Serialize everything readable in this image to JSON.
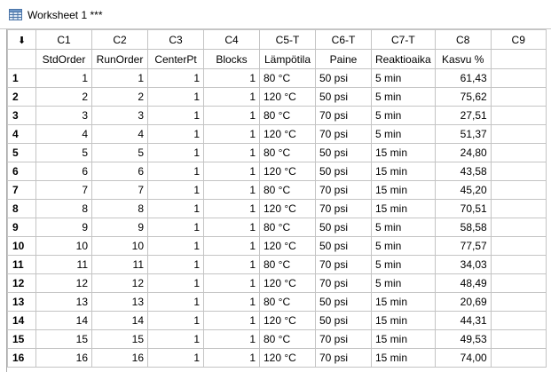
{
  "window": {
    "title": "Worksheet 1 ***",
    "icon": "worksheet-grid-icon"
  },
  "corner": {
    "label": "⬇",
    "icon": "sort-arrow-icon"
  },
  "columns": [
    {
      "id": "C1",
      "name": "StdOrder",
      "align": "num"
    },
    {
      "id": "C2",
      "name": "RunOrder",
      "align": "num"
    },
    {
      "id": "C3",
      "name": "CenterPt",
      "align": "num"
    },
    {
      "id": "C4",
      "name": "Blocks",
      "align": "num"
    },
    {
      "id": "C5-T",
      "name": "Lämpötila",
      "align": "txt"
    },
    {
      "id": "C6-T",
      "name": "Paine",
      "align": "txt"
    },
    {
      "id": "C7-T",
      "name": "Reaktioaika",
      "align": "txt"
    },
    {
      "id": "C8",
      "name": "Kasvu %",
      "align": "num"
    },
    {
      "id": "C9",
      "name": "",
      "align": "txt"
    }
  ],
  "rows": [
    {
      "n": "1",
      "cells": [
        "1",
        "1",
        "1",
        "1",
        "80 °C",
        "50 psi",
        "5 min",
        "61,43",
        ""
      ]
    },
    {
      "n": "2",
      "cells": [
        "2",
        "2",
        "1",
        "1",
        "120 °C",
        "50 psi",
        "5 min",
        "75,62",
        ""
      ]
    },
    {
      "n": "3",
      "cells": [
        "3",
        "3",
        "1",
        "1",
        "80 °C",
        "70 psi",
        "5 min",
        "27,51",
        ""
      ]
    },
    {
      "n": "4",
      "cells": [
        "4",
        "4",
        "1",
        "1",
        "120 °C",
        "70 psi",
        "5 min",
        "51,37",
        ""
      ]
    },
    {
      "n": "5",
      "cells": [
        "5",
        "5",
        "1",
        "1",
        "80 °C",
        "50 psi",
        "15 min",
        "24,80",
        ""
      ]
    },
    {
      "n": "6",
      "cells": [
        "6",
        "6",
        "1",
        "1",
        "120 °C",
        "50 psi",
        "15 min",
        "43,58",
        ""
      ]
    },
    {
      "n": "7",
      "cells": [
        "7",
        "7",
        "1",
        "1",
        "80 °C",
        "70 psi",
        "15 min",
        "45,20",
        ""
      ]
    },
    {
      "n": "8",
      "cells": [
        "8",
        "8",
        "1",
        "1",
        "120 °C",
        "70 psi",
        "15 min",
        "70,51",
        ""
      ]
    },
    {
      "n": "9",
      "cells": [
        "9",
        "9",
        "1",
        "1",
        "80 °C",
        "50 psi",
        "5 min",
        "58,58",
        ""
      ]
    },
    {
      "n": "10",
      "cells": [
        "10",
        "10",
        "1",
        "1",
        "120 °C",
        "50 psi",
        "5 min",
        "77,57",
        ""
      ]
    },
    {
      "n": "11",
      "cells": [
        "11",
        "11",
        "1",
        "1",
        "80 °C",
        "70 psi",
        "5 min",
        "34,03",
        ""
      ]
    },
    {
      "n": "12",
      "cells": [
        "12",
        "12",
        "1",
        "1",
        "120 °C",
        "70 psi",
        "5 min",
        "48,49",
        ""
      ]
    },
    {
      "n": "13",
      "cells": [
        "13",
        "13",
        "1",
        "1",
        "80 °C",
        "50 psi",
        "15 min",
        "20,69",
        ""
      ]
    },
    {
      "n": "14",
      "cells": [
        "14",
        "14",
        "1",
        "1",
        "120 °C",
        "50 psi",
        "15 min",
        "44,31",
        ""
      ]
    },
    {
      "n": "15",
      "cells": [
        "15",
        "15",
        "1",
        "1",
        "80 °C",
        "70 psi",
        "15 min",
        "49,53",
        ""
      ]
    },
    {
      "n": "16",
      "cells": [
        "16",
        "16",
        "1",
        "1",
        "120 °C",
        "70 psi",
        "15 min",
        "74,00",
        ""
      ]
    }
  ]
}
